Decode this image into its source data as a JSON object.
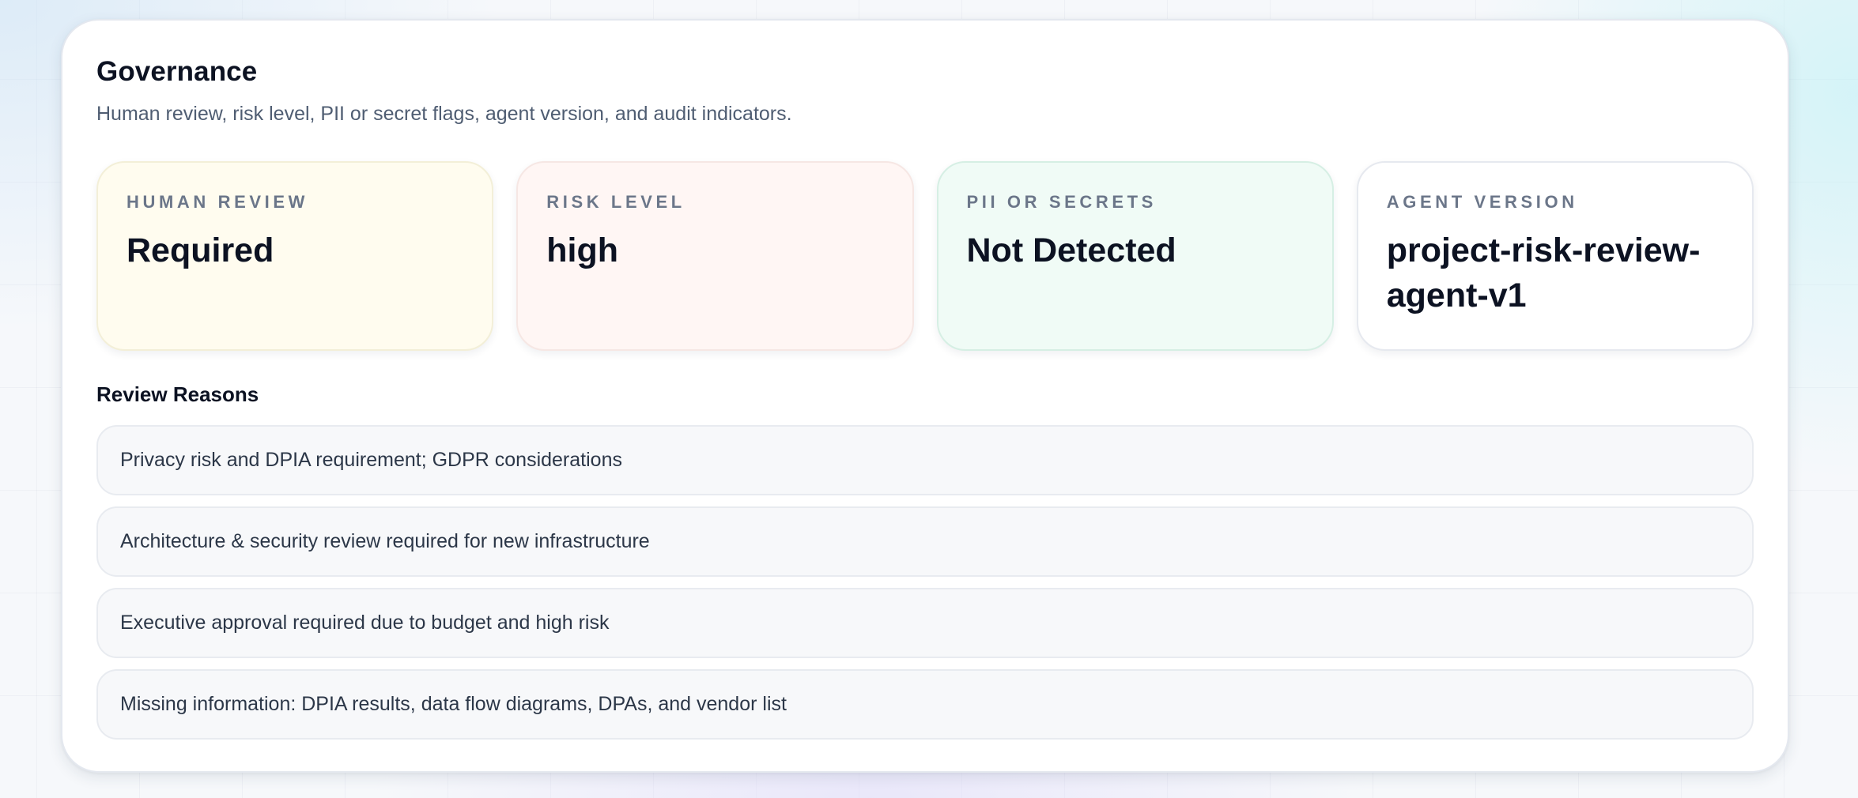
{
  "governance": {
    "title": "Governance",
    "subtitle": "Human review, risk level, PII or secret flags, agent version, and audit indicators."
  },
  "cards": [
    {
      "label": "HUMAN REVIEW",
      "value": "Required",
      "tone": "#fffcef"
    },
    {
      "label": "RISK LEVEL",
      "value": "high",
      "tone": "#fff6f4"
    },
    {
      "label": "PII OR SECRETS",
      "value": "Not Detected",
      "tone": "#f0fbf6"
    },
    {
      "label": "AGENT VERSION",
      "value": "project-risk-review-agent-v1",
      "tone": "#ffffff"
    }
  ],
  "review_reasons": {
    "title": "Review Reasons",
    "items": [
      "Privacy risk and DPIA requirement; GDPR considerations",
      "Architecture & security review required for new infrastructure",
      "Executive approval required due to budget and high risk",
      "Missing information: DPIA results, data flow diagrams, DPAs, and vendor list"
    ]
  }
}
